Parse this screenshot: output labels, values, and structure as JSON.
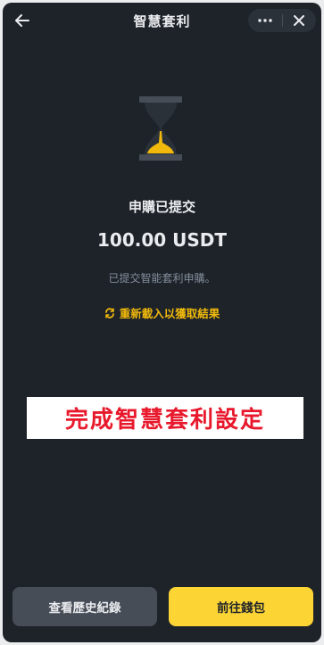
{
  "header": {
    "title": "智慧套利",
    "back_icon": "arrow-left-icon",
    "more_icon": "more-dots-icon",
    "close_icon": "close-icon"
  },
  "status": {
    "icon": "hourglass-icon",
    "title": "申購已提交",
    "amount": "100.00 USDT",
    "description": "已提交智能套利申購。",
    "reload_label": "重新載入以獲取結果",
    "reload_icon": "refresh-icon"
  },
  "banner": {
    "text": "完成智慧套利設定"
  },
  "footer": {
    "history_button": "查看歷史紀錄",
    "wallet_button": "前往錢包"
  },
  "colors": {
    "background": "#1e2329",
    "accent": "#f0b90b",
    "primary_button": "#fcd535",
    "secondary_button": "#474d57",
    "banner_text": "#e8192c"
  }
}
